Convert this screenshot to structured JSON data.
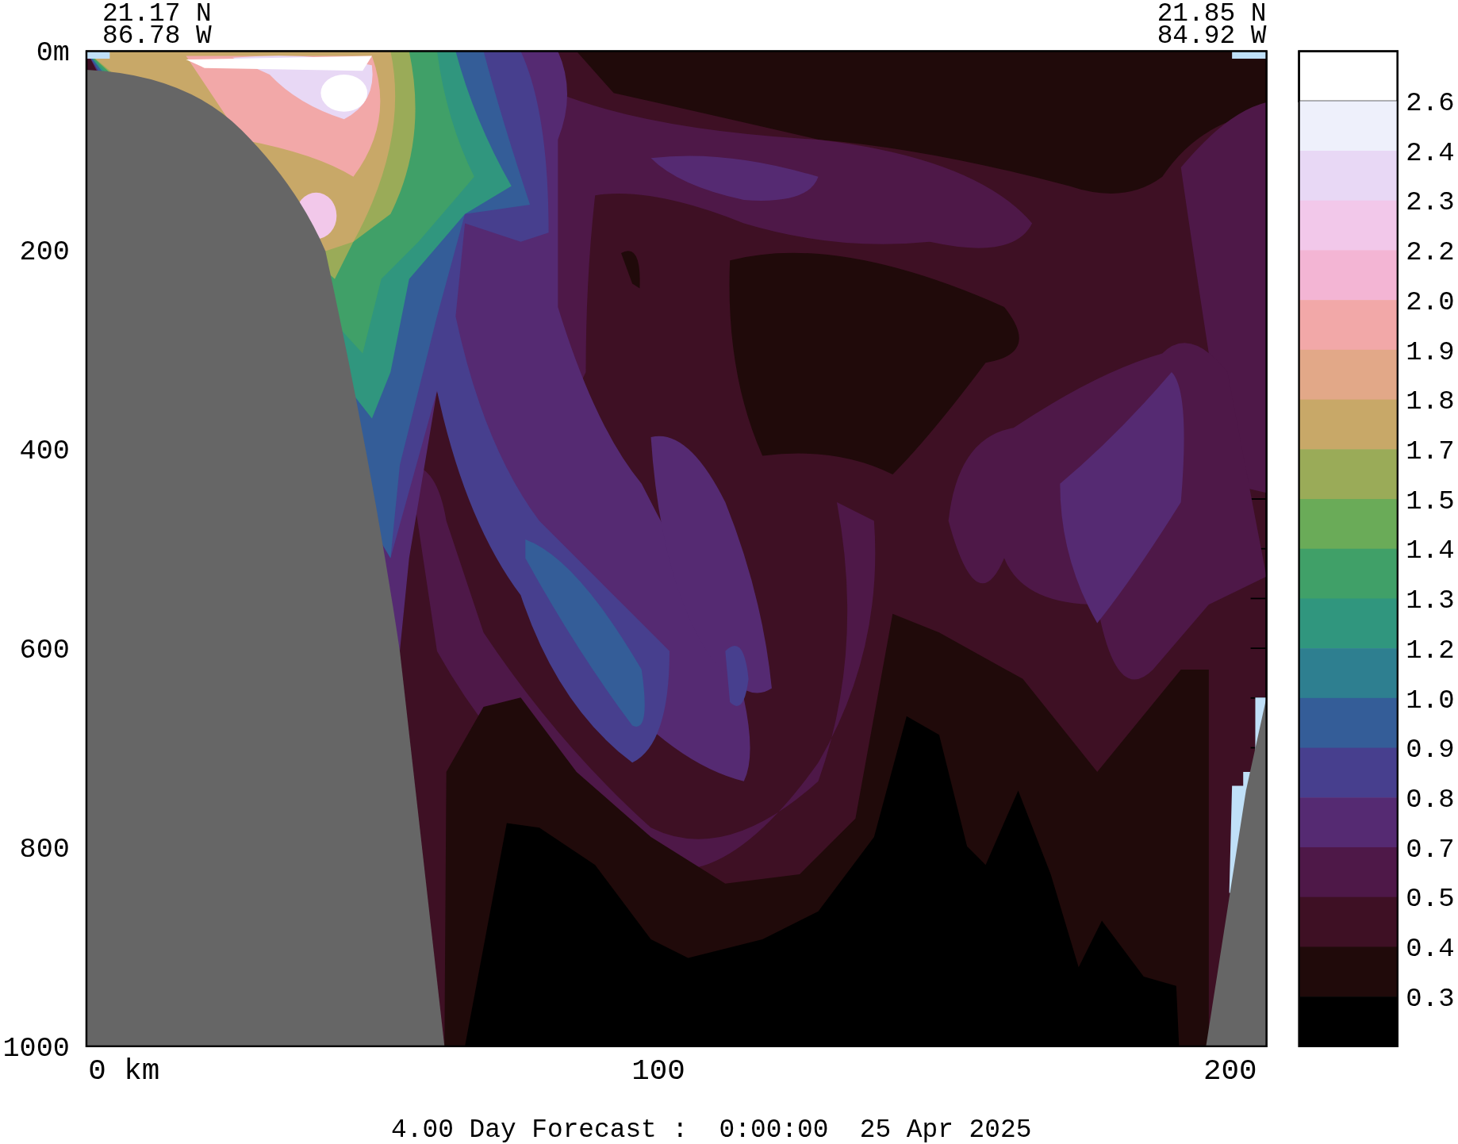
{
  "header": {
    "start_lat": "21.17 N",
    "start_lon": "86.78 W",
    "end_lat": "21.85 N",
    "end_lon": "84.92 W"
  },
  "y_axis": {
    "labels": [
      "0m",
      "200",
      "400",
      "600",
      "800",
      "1000"
    ]
  },
  "x_axis": {
    "labels": [
      "0 km",
      "100",
      "200"
    ]
  },
  "colorbar": {
    "bands": [
      {
        "color": "#ffffff"
      },
      {
        "color": "#eef0fb"
      },
      {
        "color": "#e8d8f5"
      },
      {
        "color": "#f2c8ea"
      },
      {
        "color": "#f3b5d4"
      },
      {
        "color": "#f2a8a8"
      },
      {
        "color": "#e2a888"
      },
      {
        "color": "#c8a868"
      },
      {
        "color": "#9aab58"
      },
      {
        "color": "#6aab58"
      },
      {
        "color": "#40a068"
      },
      {
        "color": "#30967e"
      },
      {
        "color": "#2e7f90"
      },
      {
        "color": "#345d98"
      },
      {
        "color": "#473f8e"
      },
      {
        "color": "#552a72"
      },
      {
        "color": "#4e1848"
      },
      {
        "color": "#3e1024"
      },
      {
        "color": "#200a0a"
      },
      {
        "color": "#000000"
      }
    ],
    "labels": [
      "2.6",
      "2.4",
      "2.3",
      "2.2",
      "2.0",
      "1.9",
      "1.8",
      "1.7",
      "1.5",
      "1.4",
      "1.3",
      "1.2",
      "1.0",
      "0.9",
      "0.8",
      "0.7",
      "0.5",
      "0.4",
      "0.3"
    ]
  },
  "caption": "4.00 Day Forecast :  0:00:00  25 Apr 2025"
}
